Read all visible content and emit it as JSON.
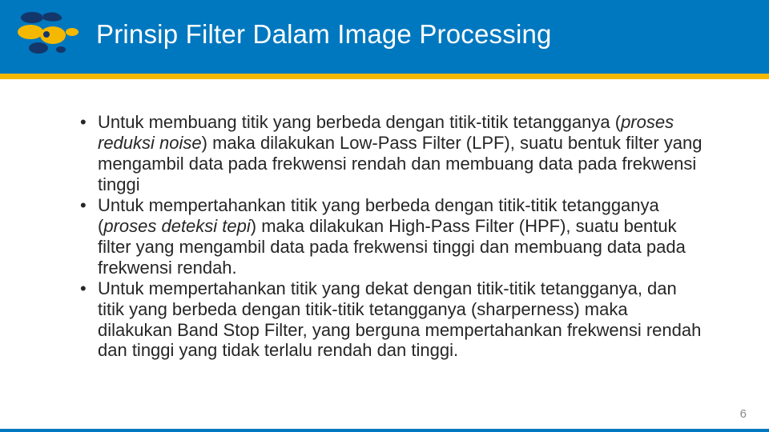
{
  "header": {
    "title": "Prinsip Filter Dalam Image Processing"
  },
  "bullets": [
    {
      "pre": "Untuk membuang titik yang berbeda dengan titik-titik tetangganya (",
      "italic": "proses reduksi noise",
      "post": ") maka dilakukan Low-Pass Filter (LPF), suatu bentuk filter yang mengambil data pada frekwensi rendah dan membuang data pada frekwensi tinggi"
    },
    {
      "pre": "Untuk mempertahankan titik yang berbeda dengan titik-titik tetangganya (",
      "italic": "proses deteksi tepi",
      "post": ") maka dilakukan High-Pass Filter (HPF), suatu bentuk filter yang mengambil data pada frekwensi tinggi dan membuang data pada frekwensi rendah."
    },
    {
      "pre": "Untuk mempertahankan titik yang dekat dengan titik-titik tetangganya, dan titik yang berbeda dengan titik-titik tetangganya (sharperness) maka dilakukan Band Stop Filter, yang berguna mempertahankan frekwensi rendah dan tinggi yang tidak terlalu rendah dan tinggi.",
      "italic": "",
      "post": ""
    }
  ],
  "page_number": "6",
  "colors": {
    "header_blue": "#0078bf",
    "accent_yellow": "#f5b800",
    "logo_yellow": "#f5b800",
    "logo_navy": "#14376b"
  }
}
